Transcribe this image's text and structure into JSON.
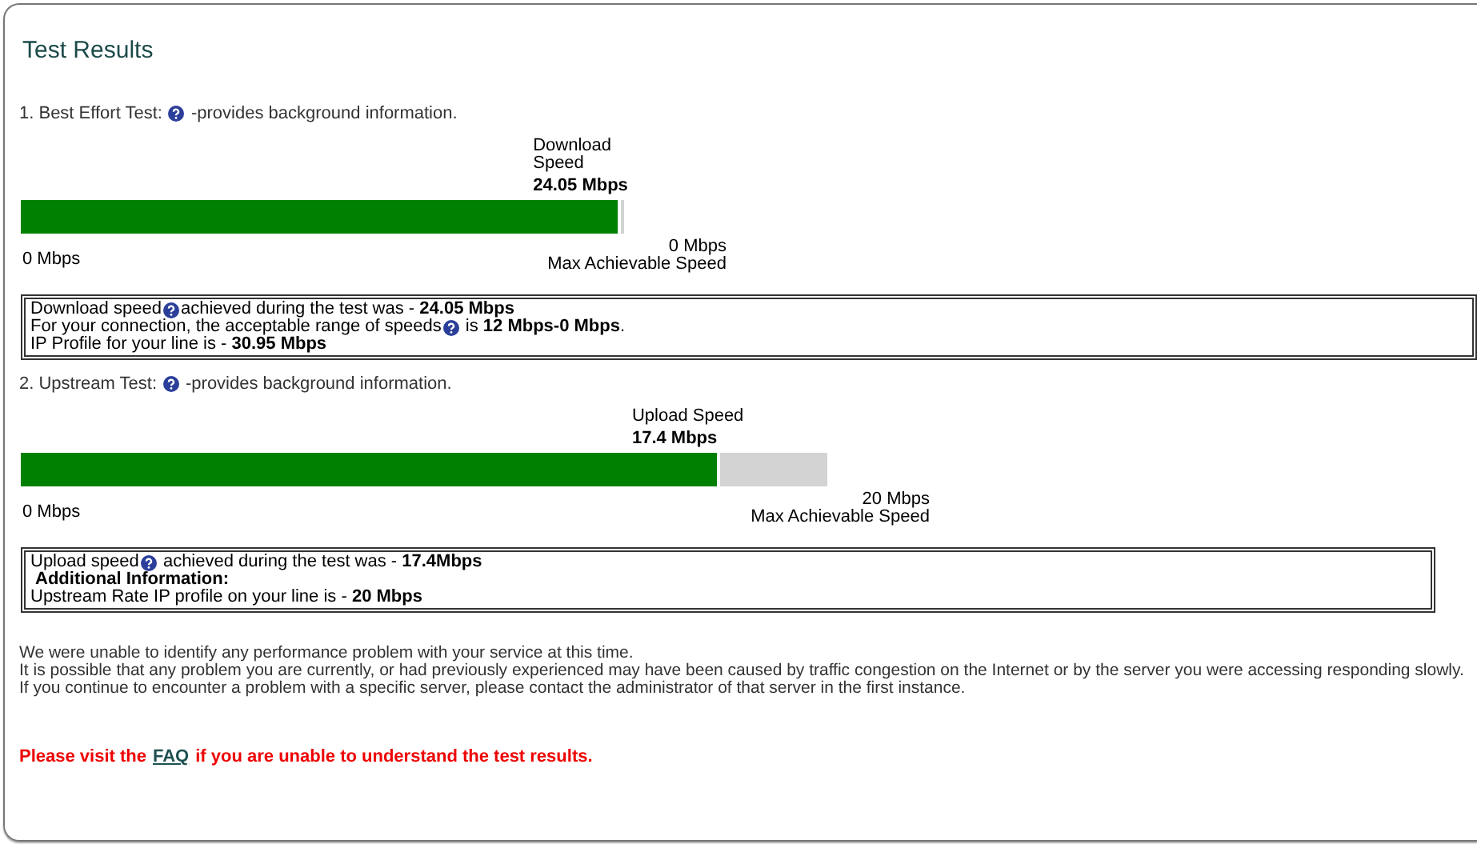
{
  "title": "Test Results",
  "tests": [
    {
      "heading": "1. Best Effort Test:",
      "hint": "-provides background information.",
      "bar": {
        "label": "Download Speed",
        "reading": "24.05 Mbps",
        "level": 0.995,
        "min": "0 Mbps",
        "max": "0 Mbps",
        "max_caption": "Max Achievable Speed"
      },
      "info": [
        {
          "kind": "help",
          "before": "Download speed",
          "after": "achieved during the test was - **24.05 Mbps**"
        },
        {
          "kind": "help",
          "before": "For your connection, the acceptable range of speeds",
          "after": " is **12 Mbps-0 Mbps**."
        },
        {
          "kind": "plain",
          "text": "IP Profile for your line is - **30.95 Mbps**"
        }
      ]
    },
    {
      "heading": "2. Upstream Test:",
      "hint": "-provides background information.",
      "bar": {
        "label": "Upload Speed",
        "reading": "17.4 Mbps",
        "level": 0.867,
        "min": "0 Mbps",
        "max": "20 Mbps",
        "max_caption": "Max Achievable Speed"
      },
      "info": [
        {
          "kind": "help",
          "before": "Upload speed",
          "after": " achieved during the test was - **17.4Mbps**"
        },
        {
          "kind": "subheading",
          "text": "Additional Information:"
        },
        {
          "kind": "plain",
          "text": "Upstream Rate IP profile on your line is - **20 Mbps**"
        }
      ]
    }
  ],
  "summary": [
    "We were unable to identify any performance problem with your service at this time.",
    "It is possible that any problem you are currently, or had previously experienced may have been caused by traffic congestion on the Internet or by the server you were accessing responding slowly.",
    "If you continue to encounter a problem with a specific server, please contact the administrator of that server in the first instance."
  ],
  "notice": {
    "before": "Please visit the",
    "link": "FAQ",
    "after": "if you are unable to understand the test results."
  }
}
